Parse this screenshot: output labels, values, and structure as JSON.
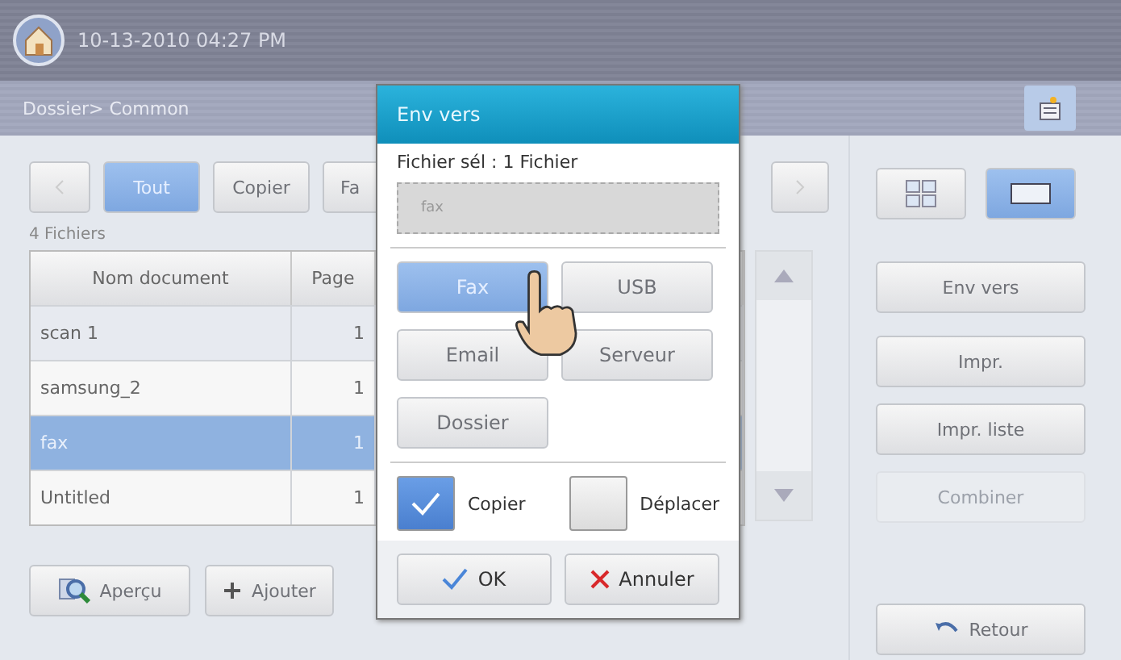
{
  "status_bar": {
    "datetime": "10-13-2010 04:27 PM"
  },
  "breadcrumb": "Dossier> Common",
  "tabs": [
    {
      "label": "Tout",
      "selected": true
    },
    {
      "label": "Copier",
      "selected": false
    },
    {
      "label": "Fa",
      "selected": false
    }
  ],
  "file_count": "4 Fichiers",
  "table": {
    "columns": [
      "Nom document",
      "Page"
    ],
    "rows": [
      {
        "name": "scan 1",
        "page": "1",
        "selected": false
      },
      {
        "name": "samsung_2",
        "page": "1",
        "selected": false
      },
      {
        "name": "fax",
        "page": "1",
        "selected": true
      },
      {
        "name": "Untitled",
        "page": "1",
        "selected": false
      }
    ]
  },
  "bottom_buttons": [
    {
      "kind": "preview",
      "label": "Aperçu"
    },
    {
      "kind": "add",
      "label": "Ajouter"
    }
  ],
  "view_modes": [
    {
      "kind": "grid",
      "selected": false
    },
    {
      "kind": "single",
      "selected": true
    }
  ],
  "actions": [
    {
      "label": "Env vers",
      "disabled": false
    },
    {
      "label": "Impr.",
      "disabled": false
    },
    {
      "label": "Impr. liste",
      "disabled": false
    },
    {
      "label": "Combiner",
      "disabled": true
    }
  ],
  "back_button": "Retour",
  "dialog": {
    "title": "Env vers",
    "selection": "Fichier sél : 1 Fichier",
    "file_name": "fax",
    "destinations": [
      {
        "label": "Fax",
        "selected": true
      },
      {
        "label": "USB",
        "selected": false
      },
      {
        "label": "Email",
        "selected": false
      },
      {
        "label": "Serveur",
        "selected": false
      },
      {
        "label": "Dossier",
        "selected": false
      }
    ],
    "modes": [
      {
        "label": "Copier",
        "checked": true
      },
      {
        "label": "Déplacer",
        "checked": false
      }
    ],
    "buttons": [
      {
        "kind": "ok",
        "label": "OK"
      },
      {
        "kind": "cancel",
        "label": "Annuler"
      }
    ]
  }
}
